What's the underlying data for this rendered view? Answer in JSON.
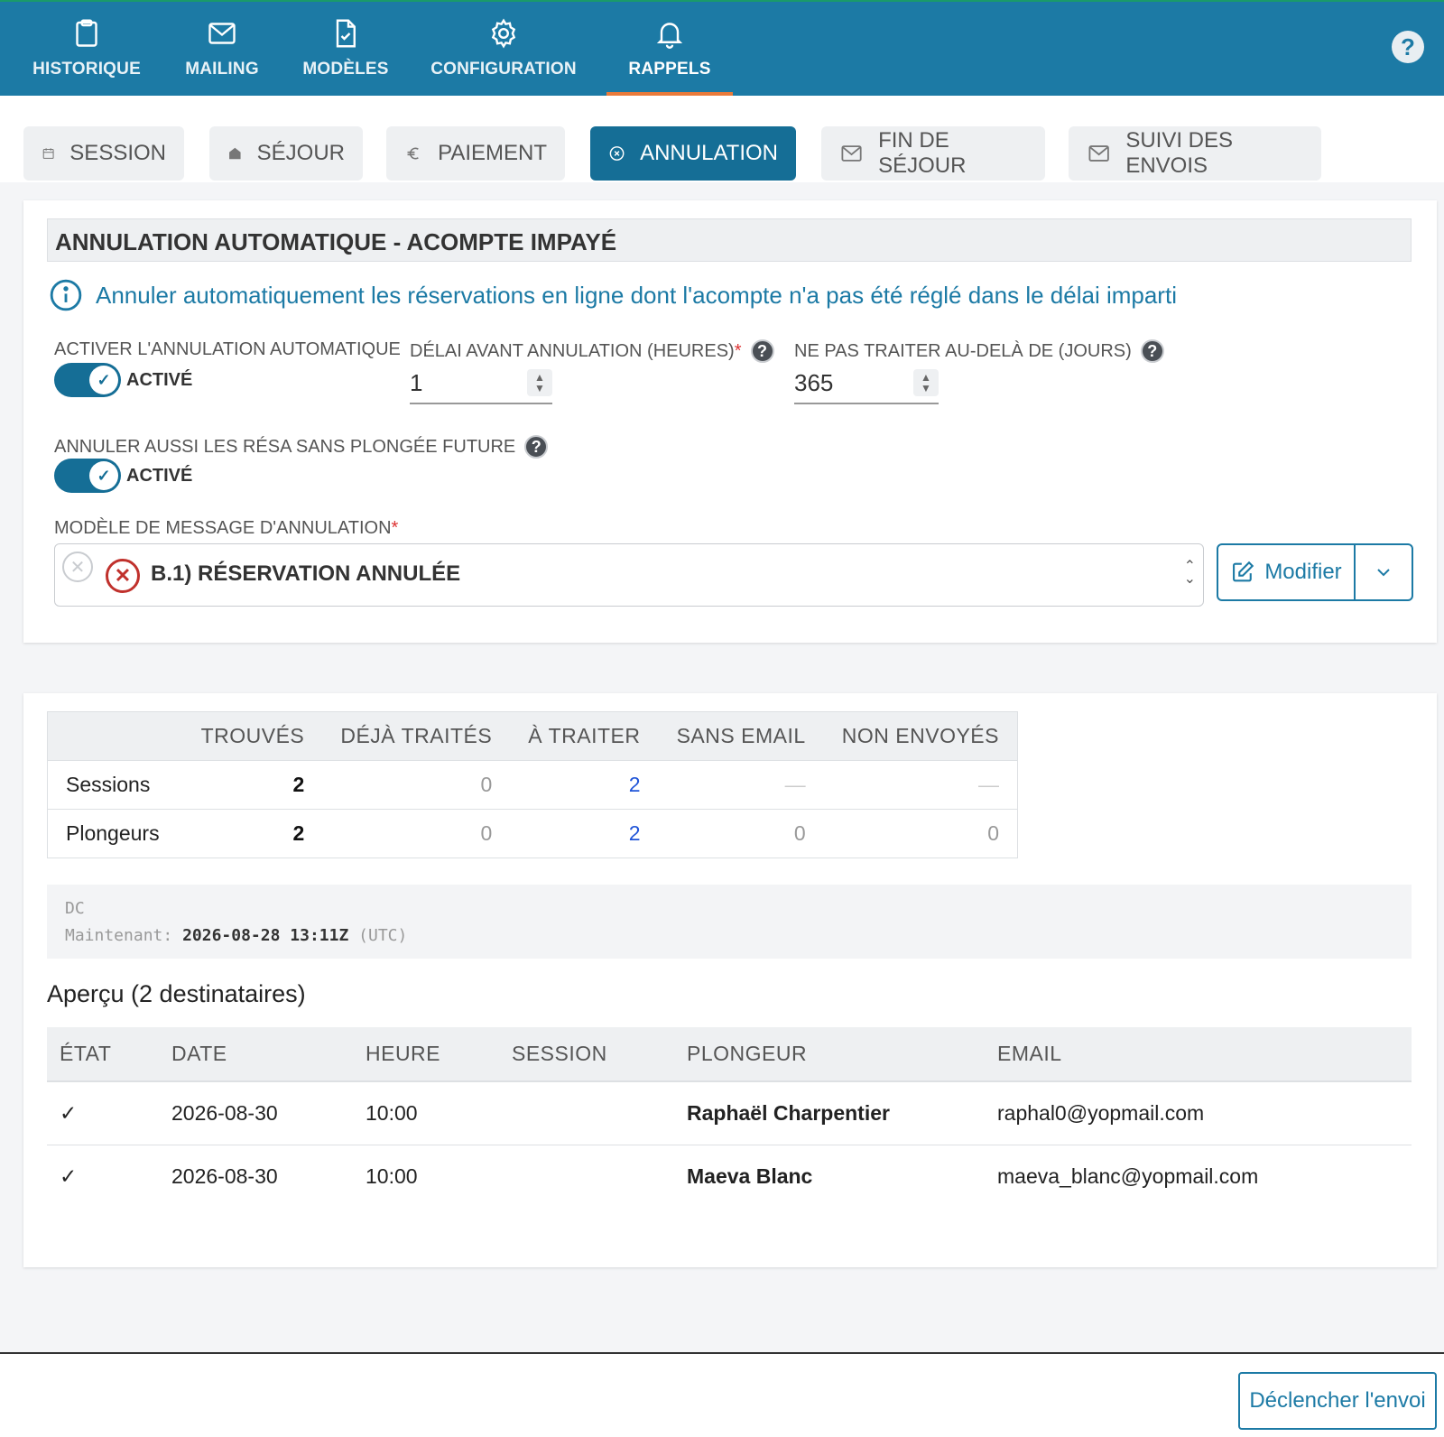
{
  "topnav": {
    "items": [
      {
        "label": "HISTORIQUE",
        "icon": "clipboard-icon"
      },
      {
        "label": "MAILING",
        "icon": "envelope-icon"
      },
      {
        "label": "MODÈLES",
        "icon": "file-check-icon"
      },
      {
        "label": "CONFIGURATION",
        "icon": "gear-icon"
      },
      {
        "label": "RAPPELS",
        "icon": "bell-icon",
        "active": true
      }
    ],
    "help": "?"
  },
  "subtabs": [
    {
      "label": "SESSION",
      "icon": "calendar-icon"
    },
    {
      "label": "SÉJOUR",
      "icon": "house-icon"
    },
    {
      "label": "PAIEMENT",
      "icon": "euro-icon"
    },
    {
      "label": "ANNULATION",
      "icon": "circle-x-icon",
      "active": true
    },
    {
      "label": "FIN DE SÉJOUR",
      "icon": "envelope-icon"
    },
    {
      "label": "SUIVI DES ENVOIS",
      "icon": "envelope-icon"
    }
  ],
  "auto_cancel": {
    "title": "ANNULATION AUTOMATIQUE - ACOMPTE IMPAYÉ",
    "info": "Annuler automatiquement les réservations en ligne dont l'acompte n'a pas été réglé dans le délai imparti",
    "enable_label": "ACTIVER L'ANNULATION AUTOMATIQUE",
    "enable_state": "ACTIVÉ",
    "delay_label": "DÉLAI AVANT ANNULATION (HEURES)",
    "required_mark": "*",
    "delay_value": "1",
    "limit_label": "NE PAS TRAITER AU-DELÀ DE (JOURS)",
    "limit_value": "365",
    "also_cancel_label": "ANNULER AUSSI LES RÉSA SANS PLONGÉE FUTURE",
    "also_cancel_state": "ACTIVÉ",
    "template_label": "MODÈLE DE MESSAGE D'ANNULATION",
    "template_value": "B.1) RÉSERVATION ANNULÉE",
    "modify_label": "Modifier",
    "help": "?"
  },
  "stats": {
    "headers": [
      "",
      "TROUVÉS",
      "DÉJÀ TRAITÉS",
      "À TRAITER",
      "SANS EMAIL",
      "NON ENVOYÉS"
    ],
    "rows": [
      {
        "label": "Sessions",
        "found": "2",
        "done": "0",
        "todo": "2",
        "no_email": "—",
        "not_sent": "—"
      },
      {
        "label": "Plongeurs",
        "found": "2",
        "done": "0",
        "todo": "2",
        "no_email": "0",
        "not_sent": "0"
      }
    ]
  },
  "debug": {
    "line1": "DC",
    "now_label": "Maintenant:",
    "now_value": "2026-08-28 13:11Z",
    "tz": "(UTC)"
  },
  "preview": {
    "title": "Aperçu (2 destinataires)",
    "headers": [
      "ÉTAT",
      "DATE",
      "HEURE",
      "SESSION",
      "PLONGEUR",
      "EMAIL"
    ],
    "rows": [
      {
        "state": "✓",
        "date": "2026-08-30",
        "time": "10:00",
        "session": "",
        "diver": "Raphaël Charpentier",
        "email": "raphal0@yopmail.com"
      },
      {
        "state": "✓",
        "date": "2026-08-30",
        "time": "10:00",
        "session": "",
        "diver": "Maeva Blanc",
        "email": "maeva_blanc@yopmail.com"
      }
    ]
  },
  "footer": {
    "send_label": "Déclencher l'envoi"
  },
  "colors": {
    "brand": "#1c7aa5",
    "active_tab": "#156e96",
    "nav_indicator": "#e97a3a",
    "todo_blue": "#1f54d8",
    "error_red": "#c0312c"
  }
}
